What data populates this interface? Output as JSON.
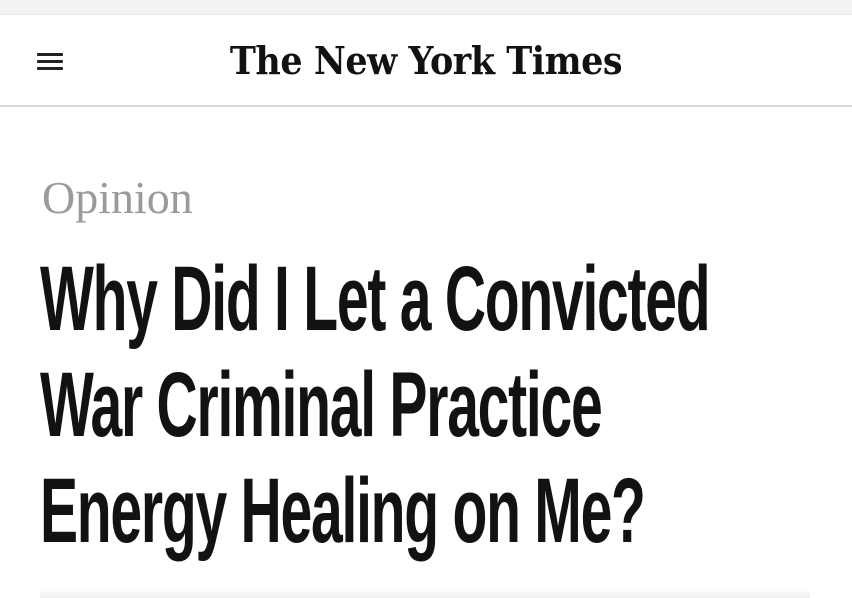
{
  "header": {
    "menu_icon": "hamburger-menu-icon",
    "logo_text": "The New York Times"
  },
  "article": {
    "section": "Opinion",
    "headline_lines": [
      "Why Did I Let a Convicted",
      "War Criminal Practice",
      "Energy Healing on Me?"
    ]
  },
  "colors": {
    "text": "#121212",
    "kicker": "#9a9a9a",
    "divider": "#d9d9d9"
  }
}
